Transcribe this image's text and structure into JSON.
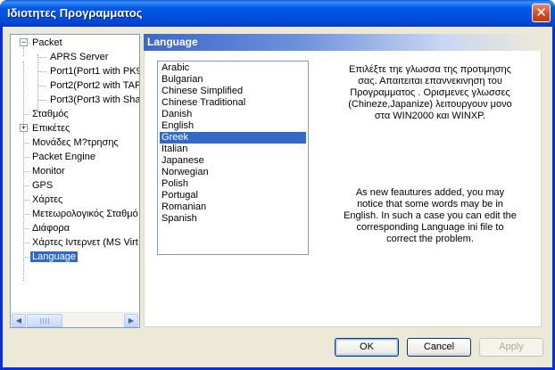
{
  "window": {
    "title": "Ιδιοτητες Προγραμματος",
    "close_glyph": "✕"
  },
  "tree": {
    "nodes": [
      {
        "label": "Packet",
        "expander": "−"
      },
      {
        "label": "APRS Server"
      },
      {
        "label": "Port1(Port1 with PK9"
      },
      {
        "label": "Port2(Port2 with TAP"
      },
      {
        "label": "Port3(Port3 with Sha"
      },
      {
        "label": "Σταθμός"
      },
      {
        "label": "Επικέτες",
        "expander": "+"
      },
      {
        "label": "Μονάδες Μ?τρησης"
      },
      {
        "label": "Packet Engine"
      },
      {
        "label": "Monitor"
      },
      {
        "label": "GPS"
      },
      {
        "label": "Χάρτες"
      },
      {
        "label": "Μετεωρολογικός Σταθμό"
      },
      {
        "label": "Διάφορα"
      },
      {
        "label": "Χάρτες Ιντερνετ (MS Virt"
      },
      {
        "label": "Language"
      }
    ],
    "selected": "Language",
    "scroll_left": "◀",
    "scroll_right": "▶"
  },
  "panel": {
    "title": "Language",
    "languages": [
      "Arabic",
      "Bulgarian",
      "Chinese Simplified",
      "Chinese Traditional",
      "Danish",
      "English",
      "Greek",
      "Italian",
      "Japanese",
      "Norwegian",
      "Polish",
      "Portugal",
      "Romanian",
      "Spanish"
    ],
    "selected_language": "Greek",
    "greek_note": [
      "Επιλέξτε τηε γλωσσα της προτιμησης",
      "σας. Απαιτειται επαννεκινηση του",
      "Προγραμματος . Ορισμενες γλωσσες",
      "(Chineze,Japanize) λειτουργουν μονο",
      "στα WIN2000 και WINXP."
    ],
    "english_note": [
      "As new feautures added, you may",
      "notice that some words may be in",
      "English. In such a case you can edit the",
      "corresponding Language ini file to",
      "correct the problem."
    ]
  },
  "buttons": {
    "ok": "OK",
    "cancel": "Cancel",
    "apply": "Apply"
  }
}
